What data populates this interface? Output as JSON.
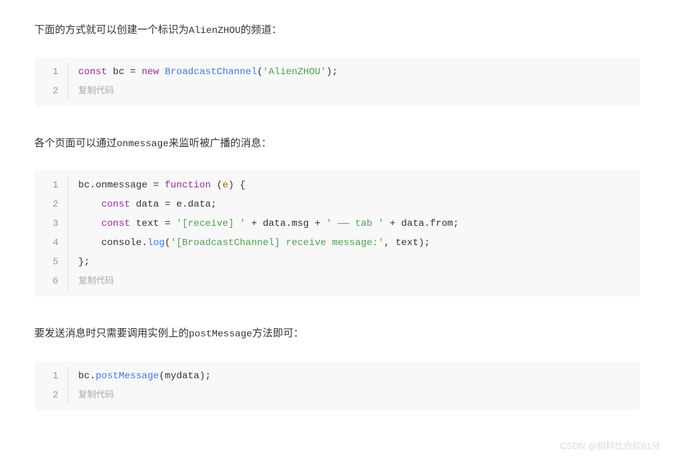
{
  "paragraphs": {
    "p1_prefix": "下面的方式就可以创建一个标识为",
    "p1_code": "AlienZHOU",
    "p1_suffix": "的频道：",
    "p2_prefix": "各个页面可以通过",
    "p2_code": "onmessage",
    "p2_suffix": "来监听被广播的消息：",
    "p3_prefix": "要发送消息时只需要调用实例上的",
    "p3_code": "postMessage",
    "p3_suffix": "方法即可："
  },
  "code_block_1": {
    "tokens": {
      "const": "const",
      "varname": " bc = ",
      "new": "new",
      "space": " ",
      "classname": "BroadcastChannel",
      "paren_open": "(",
      "string": "'AlienZHOU'",
      "paren_close": ");"
    },
    "copy_label": "复制代码",
    "line_numbers": [
      "1",
      "2"
    ]
  },
  "code_block_2": {
    "lines": {
      "l1": {
        "part1": "bc.onmessage = ",
        "kw": "function",
        "part2": " (",
        "param": "e",
        "part3": ") {"
      },
      "l2": {
        "indent": "    ",
        "kw": "const",
        "rest": " data = e.data;"
      },
      "l3": {
        "indent": "    ",
        "kw": "const",
        "part1": " text = ",
        "str1": "'[receive] '",
        "part2": " + data.msg + ",
        "str2": "' —— tab '",
        "part3": " + data.from;"
      },
      "l4": {
        "indent": "    ",
        "obj": "console.",
        "method": "log",
        "paren": "(",
        "str": "'[BroadcastChannel] receive message:'",
        "rest": ", text);"
      },
      "l5": {
        "text": "};"
      }
    },
    "copy_label": "复制代码",
    "line_numbers": [
      "1",
      "2",
      "3",
      "4",
      "5",
      "6"
    ]
  },
  "code_block_3": {
    "tokens": {
      "obj": "bc.",
      "method": "postMessage",
      "rest": "(mydata);"
    },
    "copy_label": "复制代码",
    "line_numbers": [
      "1",
      "2"
    ]
  },
  "watermark": "CSDN @和科比合砍81分"
}
